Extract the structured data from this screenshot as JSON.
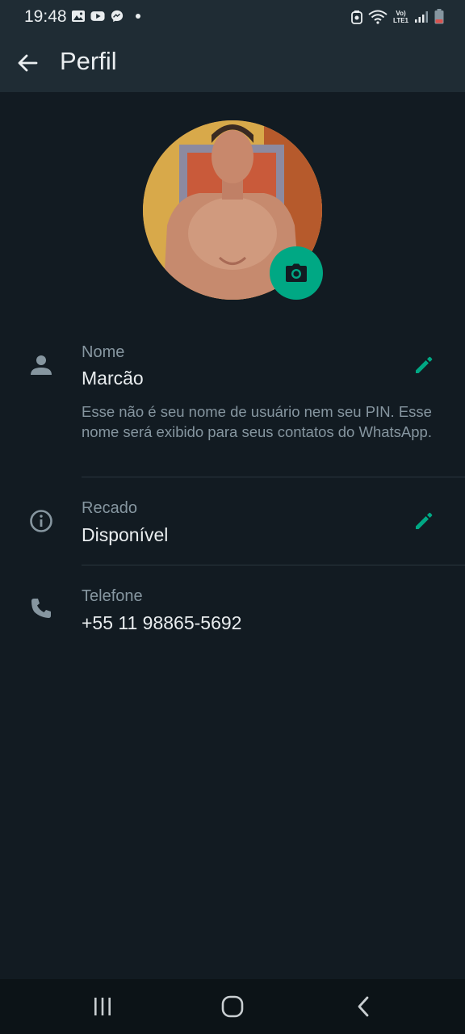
{
  "status_bar": {
    "time": "19:48",
    "left_icons": [
      "gallery-icon",
      "youtube-icon",
      "messenger-icon",
      "notification-dot"
    ],
    "right_icons": [
      "alarm-icon",
      "wifi-icon",
      "volte-icon",
      "signal-icon",
      "battery-icon"
    ],
    "volte_line1": "Vo)",
    "volte_line2": "LTE1"
  },
  "app_bar": {
    "title": "Perfil"
  },
  "profile": {
    "name_label": "Nome",
    "name_value": "Marcão",
    "name_hint": "Esse não é seu nome de usuário nem seu PIN. Esse nome será exibido para seus contatos do WhatsApp.",
    "about_label": "Recado",
    "about_value": "Disponível",
    "phone_label": "Telefone",
    "phone_value": "+55 11 98865-5692"
  },
  "colors": {
    "background": "#121b22",
    "bar": "#1f2c34",
    "accent": "#00a884",
    "secondary_text": "#8696a0",
    "primary_text": "#e9edef"
  }
}
